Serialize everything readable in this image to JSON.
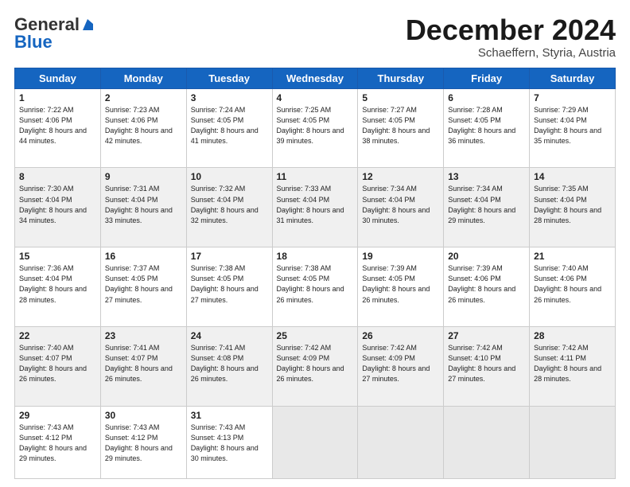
{
  "logo": {
    "general": "General",
    "blue": "Blue"
  },
  "header": {
    "month": "December 2024",
    "location": "Schaeffern, Styria, Austria"
  },
  "days": [
    "Sunday",
    "Monday",
    "Tuesday",
    "Wednesday",
    "Thursday",
    "Friday",
    "Saturday"
  ],
  "weeks": [
    [
      {
        "day": "1",
        "sunrise": "7:22 AM",
        "sunset": "4:06 PM",
        "daylight": "8 hours and 44 minutes."
      },
      {
        "day": "2",
        "sunrise": "7:23 AM",
        "sunset": "4:06 PM",
        "daylight": "8 hours and 42 minutes."
      },
      {
        "day": "3",
        "sunrise": "7:24 AM",
        "sunset": "4:05 PM",
        "daylight": "8 hours and 41 minutes."
      },
      {
        "day": "4",
        "sunrise": "7:25 AM",
        "sunset": "4:05 PM",
        "daylight": "8 hours and 39 minutes."
      },
      {
        "day": "5",
        "sunrise": "7:27 AM",
        "sunset": "4:05 PM",
        "daylight": "8 hours and 38 minutes."
      },
      {
        "day": "6",
        "sunrise": "7:28 AM",
        "sunset": "4:05 PM",
        "daylight": "8 hours and 36 minutes."
      },
      {
        "day": "7",
        "sunrise": "7:29 AM",
        "sunset": "4:04 PM",
        "daylight": "8 hours and 35 minutes."
      }
    ],
    [
      {
        "day": "8",
        "sunrise": "7:30 AM",
        "sunset": "4:04 PM",
        "daylight": "8 hours and 34 minutes."
      },
      {
        "day": "9",
        "sunrise": "7:31 AM",
        "sunset": "4:04 PM",
        "daylight": "8 hours and 33 minutes."
      },
      {
        "day": "10",
        "sunrise": "7:32 AM",
        "sunset": "4:04 PM",
        "daylight": "8 hours and 32 minutes."
      },
      {
        "day": "11",
        "sunrise": "7:33 AM",
        "sunset": "4:04 PM",
        "daylight": "8 hours and 31 minutes."
      },
      {
        "day": "12",
        "sunrise": "7:34 AM",
        "sunset": "4:04 PM",
        "daylight": "8 hours and 30 minutes."
      },
      {
        "day": "13",
        "sunrise": "7:34 AM",
        "sunset": "4:04 PM",
        "daylight": "8 hours and 29 minutes."
      },
      {
        "day": "14",
        "sunrise": "7:35 AM",
        "sunset": "4:04 PM",
        "daylight": "8 hours and 28 minutes."
      }
    ],
    [
      {
        "day": "15",
        "sunrise": "7:36 AM",
        "sunset": "4:04 PM",
        "daylight": "8 hours and 28 minutes."
      },
      {
        "day": "16",
        "sunrise": "7:37 AM",
        "sunset": "4:05 PM",
        "daylight": "8 hours and 27 minutes."
      },
      {
        "day": "17",
        "sunrise": "7:38 AM",
        "sunset": "4:05 PM",
        "daylight": "8 hours and 27 minutes."
      },
      {
        "day": "18",
        "sunrise": "7:38 AM",
        "sunset": "4:05 PM",
        "daylight": "8 hours and 26 minutes."
      },
      {
        "day": "19",
        "sunrise": "7:39 AM",
        "sunset": "4:05 PM",
        "daylight": "8 hours and 26 minutes."
      },
      {
        "day": "20",
        "sunrise": "7:39 AM",
        "sunset": "4:06 PM",
        "daylight": "8 hours and 26 minutes."
      },
      {
        "day": "21",
        "sunrise": "7:40 AM",
        "sunset": "4:06 PM",
        "daylight": "8 hours and 26 minutes."
      }
    ],
    [
      {
        "day": "22",
        "sunrise": "7:40 AM",
        "sunset": "4:07 PM",
        "daylight": "8 hours and 26 minutes."
      },
      {
        "day": "23",
        "sunrise": "7:41 AM",
        "sunset": "4:07 PM",
        "daylight": "8 hours and 26 minutes."
      },
      {
        "day": "24",
        "sunrise": "7:41 AM",
        "sunset": "4:08 PM",
        "daylight": "8 hours and 26 minutes."
      },
      {
        "day": "25",
        "sunrise": "7:42 AM",
        "sunset": "4:09 PM",
        "daylight": "8 hours and 26 minutes."
      },
      {
        "day": "26",
        "sunrise": "7:42 AM",
        "sunset": "4:09 PM",
        "daylight": "8 hours and 27 minutes."
      },
      {
        "day": "27",
        "sunrise": "7:42 AM",
        "sunset": "4:10 PM",
        "daylight": "8 hours and 27 minutes."
      },
      {
        "day": "28",
        "sunrise": "7:42 AM",
        "sunset": "4:11 PM",
        "daylight": "8 hours and 28 minutes."
      }
    ],
    [
      {
        "day": "29",
        "sunrise": "7:43 AM",
        "sunset": "4:12 PM",
        "daylight": "8 hours and 29 minutes."
      },
      {
        "day": "30",
        "sunrise": "7:43 AM",
        "sunset": "4:12 PM",
        "daylight": "8 hours and 29 minutes."
      },
      {
        "day": "31",
        "sunrise": "7:43 AM",
        "sunset": "4:13 PM",
        "daylight": "8 hours and 30 minutes."
      },
      null,
      null,
      null,
      null
    ]
  ]
}
